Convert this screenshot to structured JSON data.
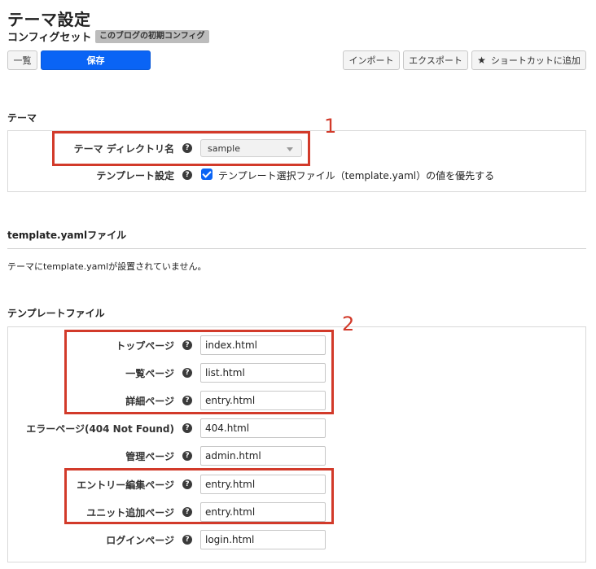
{
  "header": {
    "title": "テーマ設定",
    "subtitle": "コンフィグセット",
    "badge": "このブログの初期コンフィグ"
  },
  "toolbar": {
    "list_label": "一覧",
    "save_label": "保存",
    "import_label": "インポート",
    "export_label": "エクスポート",
    "shortcut_label": "ショートカットに追加",
    "shortcut_icon": "star-icon"
  },
  "theme_section": {
    "title": "テーマ",
    "dir_label": "テーマ ディレクトリ名",
    "dir_value": "sample",
    "template_label": "テンプレート設定",
    "template_checkbox_label": "テンプレート選択ファイル（template.yaml）の値を優先する",
    "template_checked": true
  },
  "yaml_section": {
    "title": "template.yamlファイル",
    "message": "テーマにtemplate.yamlが設置されていません。"
  },
  "template_files": {
    "title": "テンプレートファイル",
    "rows": [
      {
        "label": "トップページ",
        "value": "index.html"
      },
      {
        "label": "一覧ページ",
        "value": "list.html"
      },
      {
        "label": "詳細ページ",
        "value": "entry.html"
      },
      {
        "label": "エラーページ(404 Not Found)",
        "value": "404.html"
      },
      {
        "label": "管理ページ",
        "value": "admin.html"
      },
      {
        "label": "エントリー編集ページ",
        "value": "entry.html"
      },
      {
        "label": "ユニット追加ページ",
        "value": "entry.html"
      },
      {
        "label": "ログインページ",
        "value": "login.html"
      }
    ]
  },
  "annotations": {
    "marker1": "1",
    "marker2": "2",
    "color": "#d23a2a"
  },
  "colors": {
    "primary": "#0a64f5"
  }
}
